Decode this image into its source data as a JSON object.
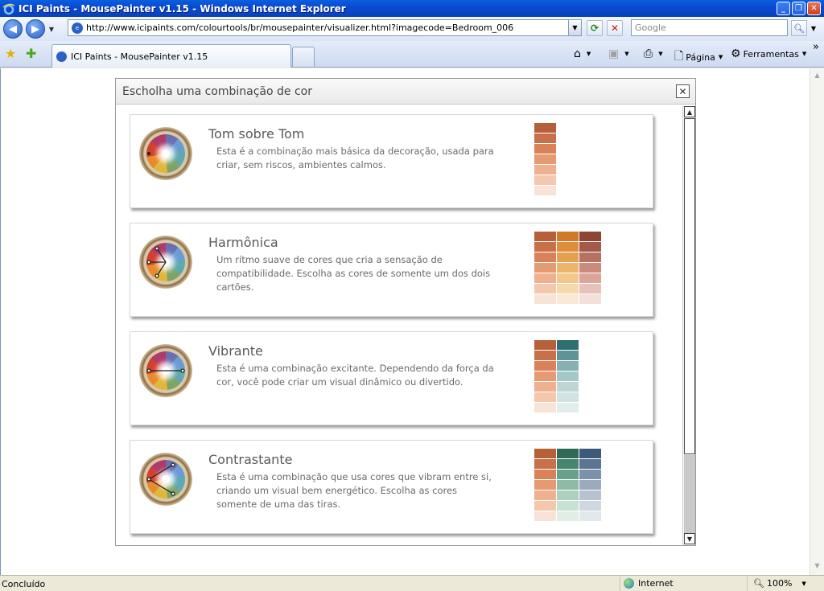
{
  "window": {
    "title": "ICI Paints - MousePainter v1.15 - Windows Internet Explorer",
    "minimize_glyph": "_",
    "maximize_glyph": "❐",
    "close_glyph": "✕"
  },
  "address_bar": {
    "url": "http://www.icipaints.com/colourtools/br/mousepainter/visualizer.html?imagecode=Bedroom_006",
    "search_placeholder": "Google"
  },
  "tabs": [
    {
      "label": "ICI Paints - MousePainter v1.15",
      "active": true
    }
  ],
  "command_bar": {
    "page_label": "Página",
    "tools_label": "Ferramentas"
  },
  "dialog": {
    "title": "Escholha uma combinação de cor",
    "close_glyph": "✕",
    "options": [
      {
        "title": "Tom sobre Tom",
        "description": "Esta é a combinação mais básica da decoração, usada para criar, sem riscos, ambientes calmos.",
        "scheme": "tone-on-tone",
        "strips": [
          [
            "#b6603a",
            "#c8704a",
            "#d9825a",
            "#e59a72",
            "#eeb08f",
            "#f4c8ad",
            "#f7e4d6"
          ]
        ]
      },
      {
        "title": "Harmônica",
        "description": "Um rítmo suave de cores que cria a sensação de compatibilidade. Escolha as cores de somente um dos dois cartões.",
        "scheme": "harmonic",
        "strips": [
          [
            "#b6603a",
            "#c8704a",
            "#d9825a",
            "#e59a72",
            "#eeb08f",
            "#f4c8ad",
            "#f7e4d6"
          ],
          [
            "#d07a28",
            "#dc8e3c",
            "#e6a052",
            "#eeb46c",
            "#f3c68a",
            "#f7d8ad",
            "#fae9d4"
          ],
          [
            "#8c4634",
            "#a35a48",
            "#b87060",
            "#cc8a7c",
            "#dba59a",
            "#e8c2ba",
            "#f3e0db"
          ]
        ]
      },
      {
        "title": "Vibrante",
        "description": "Esta é uma combinação excitante. Dependendo da força da cor, você pode criar um visual dinâmico ou divertido.",
        "scheme": "vibrant",
        "strips": [
          [
            "#b6603a",
            "#c8704a",
            "#d9825a",
            "#e59a72",
            "#eeb08f",
            "#f4c8ad",
            "#f7e4d6"
          ],
          [
            "#2f6f72",
            "#5f9496",
            "#86b0b1",
            "#a6c7c7",
            "#bed7d6",
            "#d0e3e2",
            "#e1eeec"
          ]
        ]
      },
      {
        "title": "Contrastante",
        "description": "Esta é uma combinação que usa cores que vibram entre si, criando um visual bem energético. Escolha as cores somente de uma das tiras.",
        "scheme": "contrasting",
        "strips": [
          [
            "#b6603a",
            "#c8704a",
            "#d9825a",
            "#e59a72",
            "#eeb08f",
            "#f4c8ad",
            "#f7e4d6"
          ],
          [
            "#2e6a56",
            "#46866e",
            "#68a18a",
            "#8dbba6",
            "#aed0bf",
            "#c9e1d4",
            "#e0eee6"
          ],
          [
            "#3e5a7a",
            "#5b7492",
            "#7c91a9",
            "#9baabd",
            "#b7c3d0",
            "#cfd7e0",
            "#e3e8ed"
          ]
        ]
      }
    ]
  },
  "status_bar": {
    "text": "Concluído",
    "zone": "Internet",
    "zoom": "100%"
  }
}
